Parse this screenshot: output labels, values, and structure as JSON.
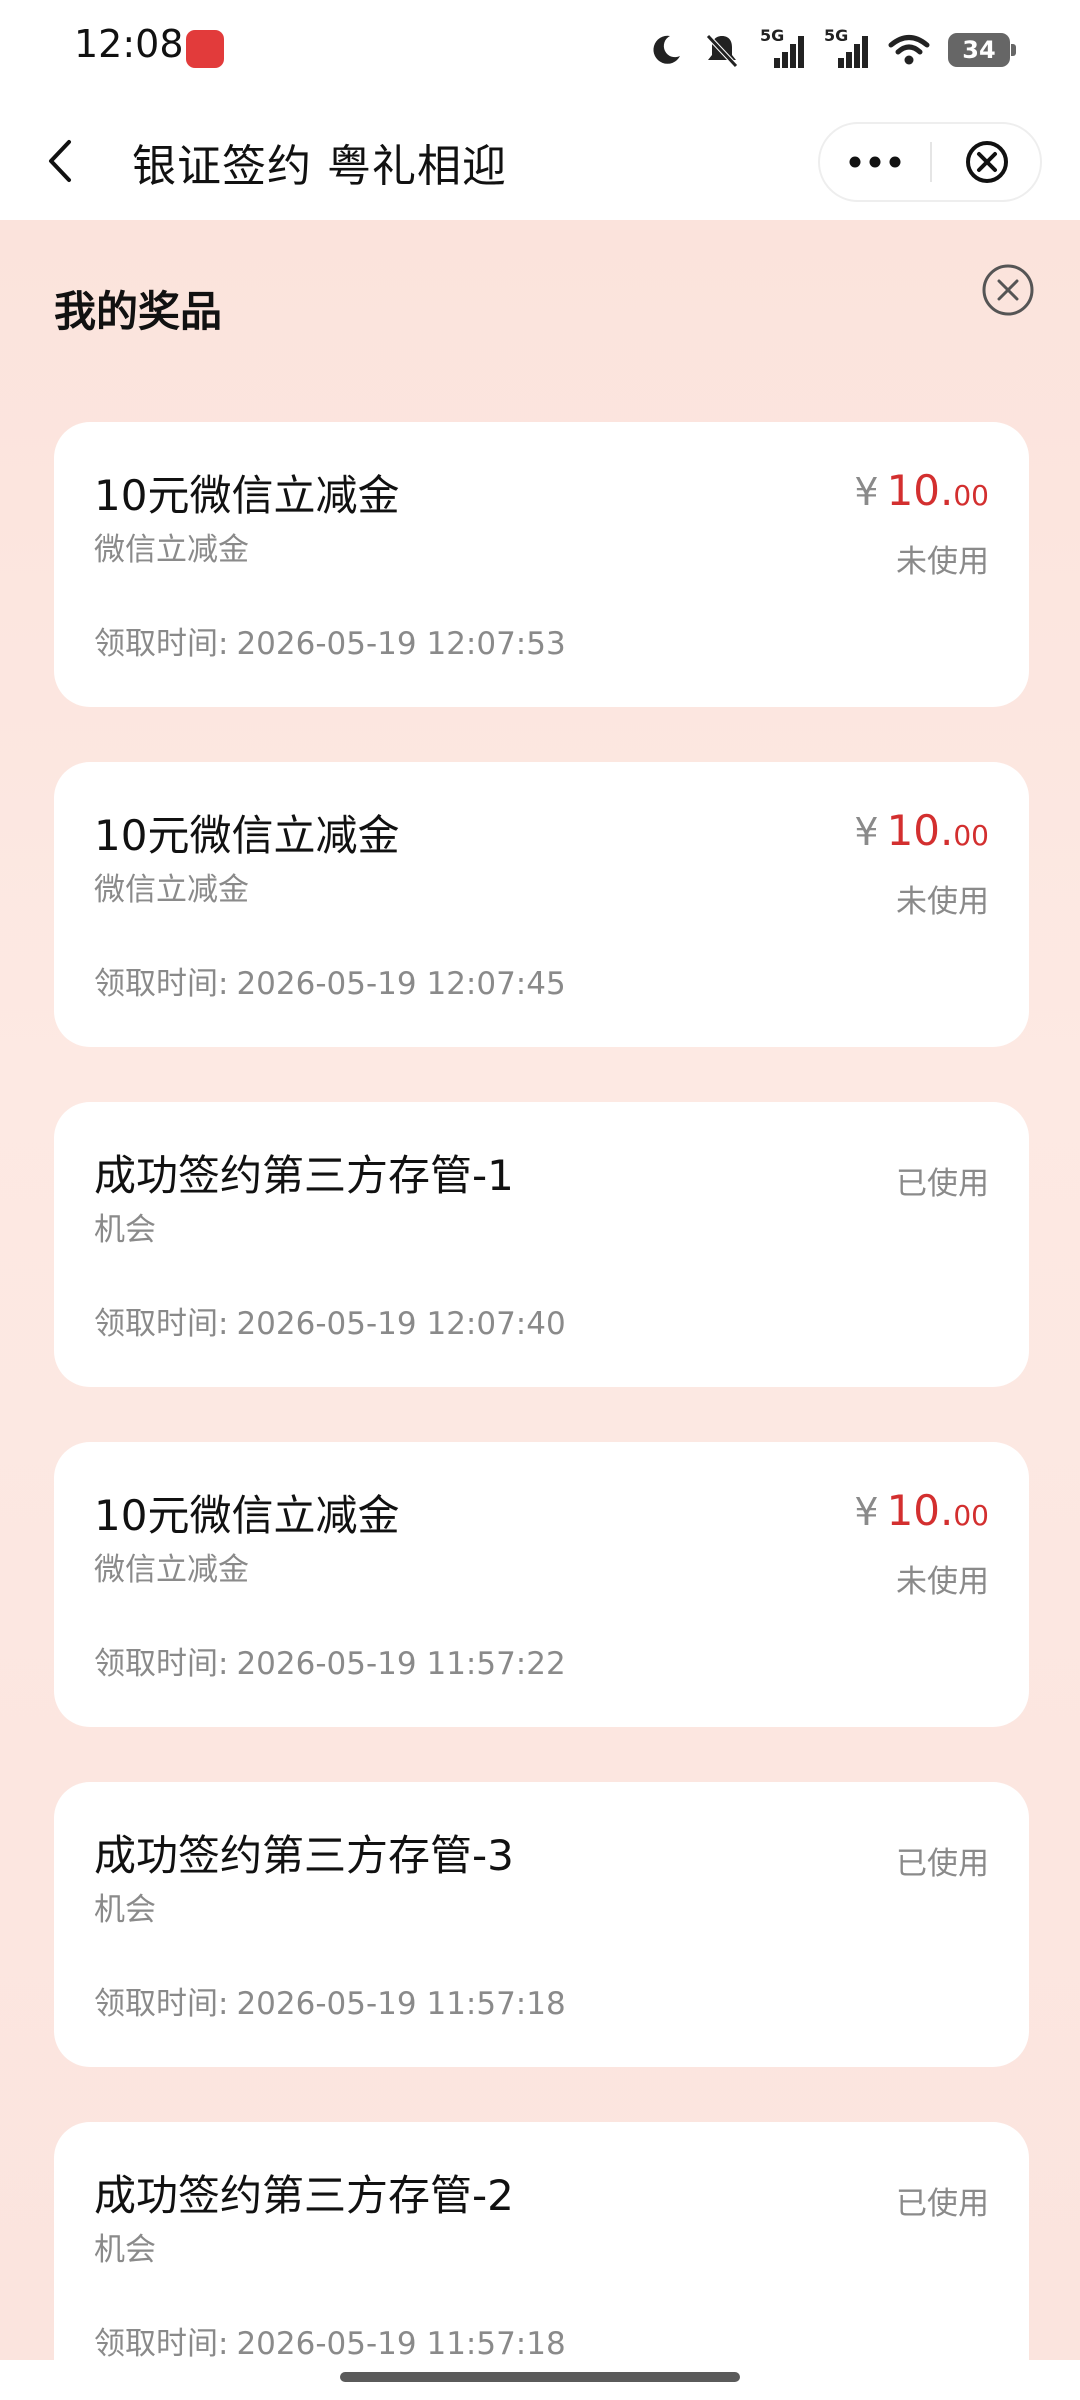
{
  "status_bar": {
    "time": "12:08",
    "signal1": "5G",
    "signal2": "5G",
    "battery": "34"
  },
  "nav": {
    "title": "银证签约 粤礼相迎"
  },
  "panel": {
    "title": "我的奖品"
  },
  "colors": {
    "accent_red": "#d32f2f",
    "background_pink": "#fbe3dc"
  },
  "prizes": [
    {
      "title": "10元微信立减金",
      "subtitle": "微信立减金",
      "time_label": "领取时间:",
      "time": "2026-05-19 12:07:53",
      "currency": "¥",
      "price_int": "10.",
      "price_dec": "00",
      "status": "未使用"
    },
    {
      "title": "10元微信立减金",
      "subtitle": "微信立减金",
      "time_label": "领取时间:",
      "time": "2026-05-19 12:07:45",
      "currency": "¥",
      "price_int": "10.",
      "price_dec": "00",
      "status": "未使用"
    },
    {
      "title": "成功签约第三方存管-1",
      "subtitle": "机会",
      "time_label": "领取时间:",
      "time": "2026-05-19 12:07:40",
      "status": "已使用"
    },
    {
      "title": "10元微信立减金",
      "subtitle": "微信立减金",
      "time_label": "领取时间:",
      "time": "2026-05-19 11:57:22",
      "currency": "¥",
      "price_int": "10.",
      "price_dec": "00",
      "status": "未使用"
    },
    {
      "title": "成功签约第三方存管-3",
      "subtitle": "机会",
      "time_label": "领取时间:",
      "time": "2026-05-19 11:57:18",
      "status": "已使用"
    },
    {
      "title": "成功签约第三方存管-2",
      "subtitle": "机会",
      "time_label": "领取时间:",
      "time": "2026-05-19 11:57:18",
      "status": "已使用"
    }
  ]
}
